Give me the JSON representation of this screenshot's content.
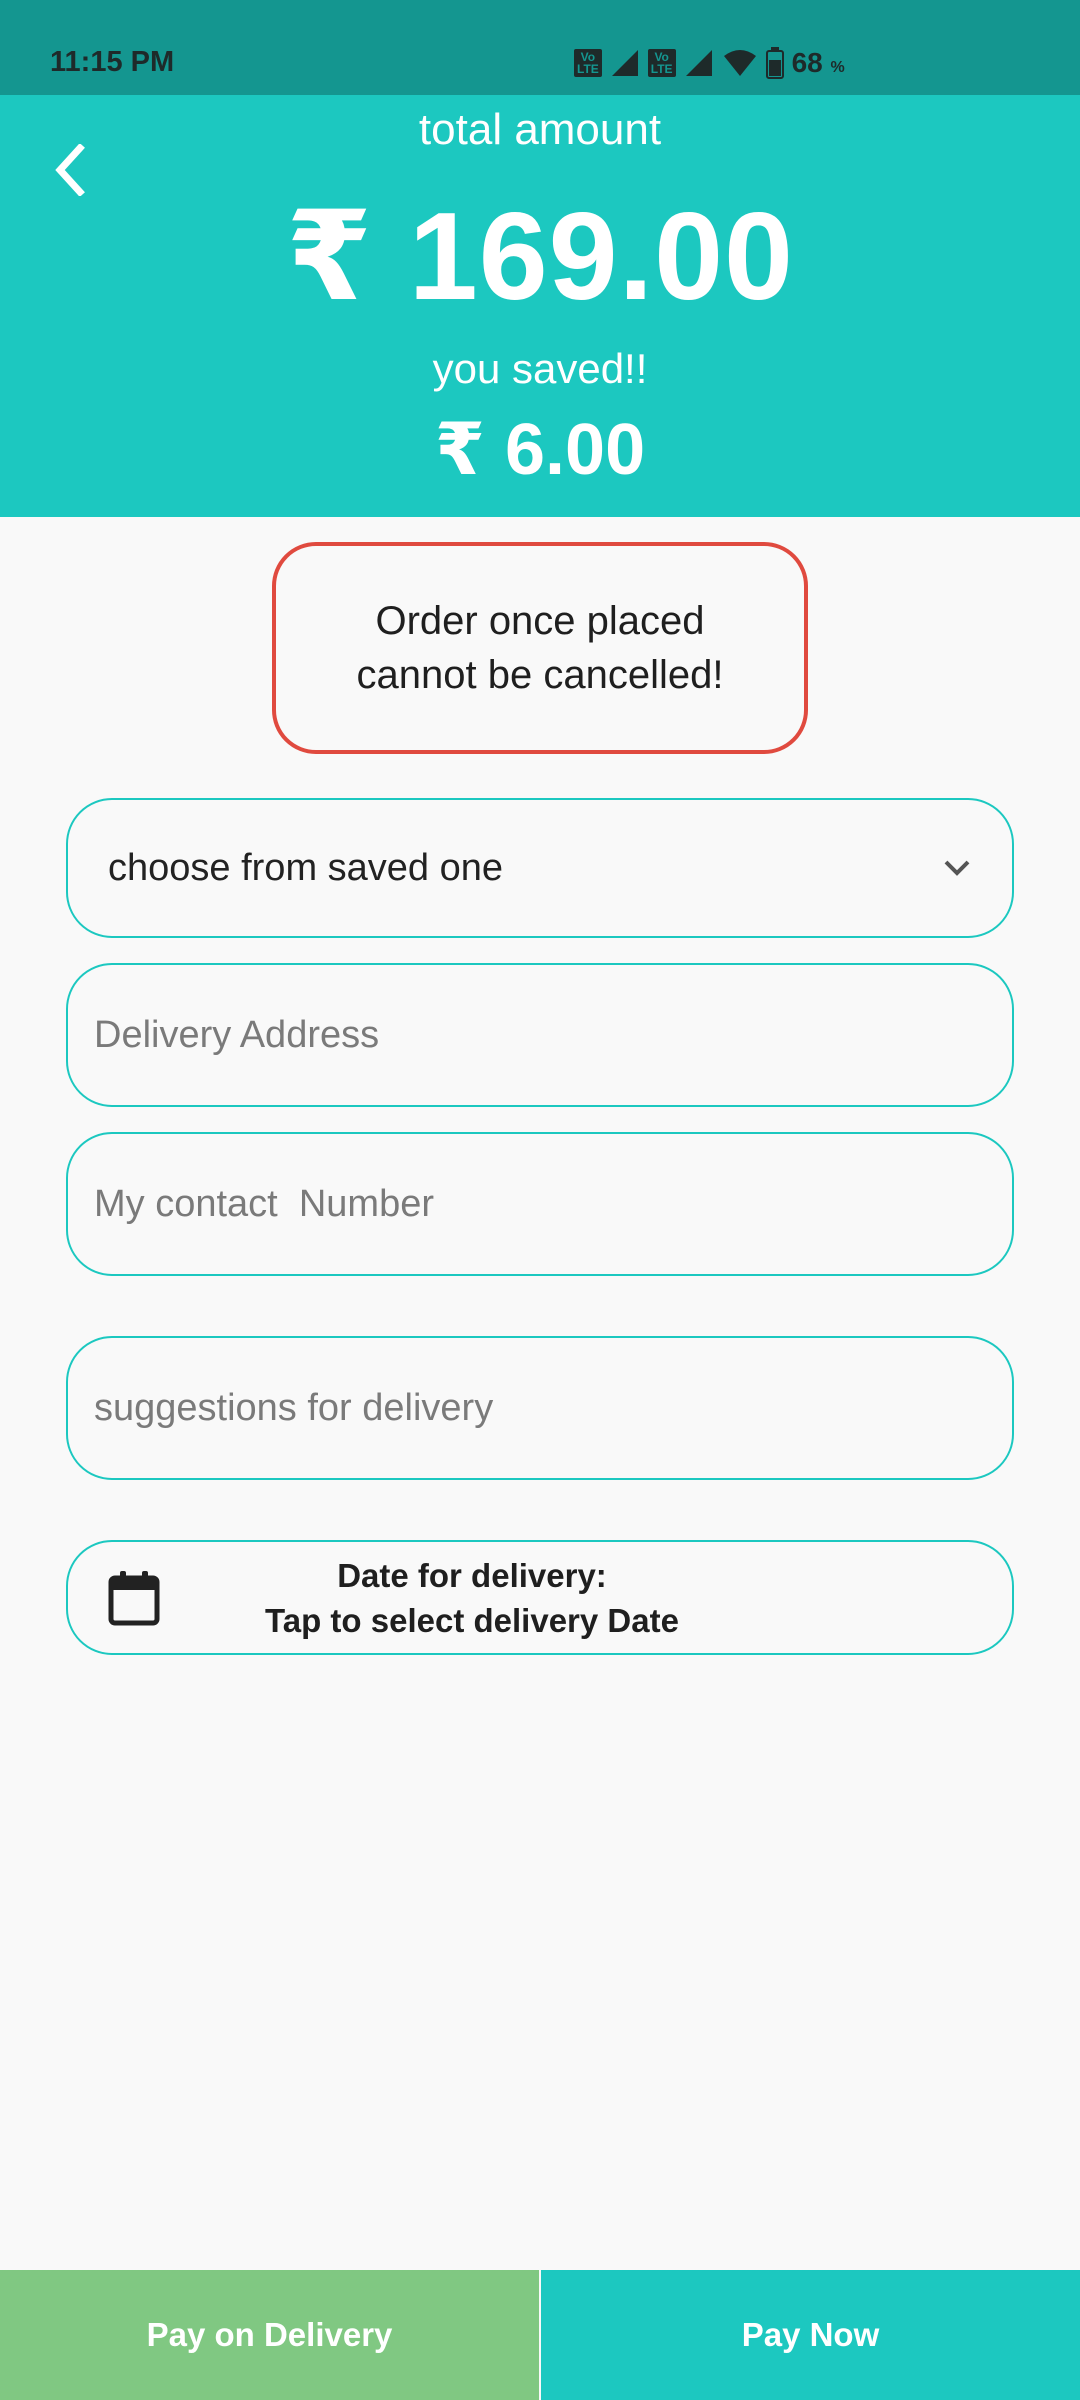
{
  "status_bar": {
    "time": "11:15 PM",
    "network_badge_1": "Vo LTE",
    "network_badge_2": "Vo LTE",
    "battery_percent": "68",
    "battery_unit": "%"
  },
  "header": {
    "back_icon": "chevron-left-icon",
    "total_label": "total amount",
    "total_amount": "₹ 169.00",
    "saved_label": "you saved!!",
    "saved_amount": "₹ 6.00"
  },
  "notice": {
    "line1": "Order once placed",
    "line2": "cannot be cancelled!"
  },
  "form": {
    "saved_address_dropdown": "choose from saved one",
    "delivery_address_placeholder": "Delivery Address",
    "contact_number_placeholder": "My contact  Number",
    "suggestions_placeholder": "suggestions for delivery",
    "date_label": "Date for delivery:",
    "date_hint": "Tap to select delivery Date"
  },
  "actions": {
    "pay_on_delivery": "Pay on Delivery",
    "pay_now": "Pay Now"
  },
  "colors": {
    "primary": "#1cc8c0",
    "status_bar": "#149690",
    "alert_border": "#e04a3f",
    "pay_on_delivery_bg": "#80c882",
    "background": "#f9f9f9"
  }
}
